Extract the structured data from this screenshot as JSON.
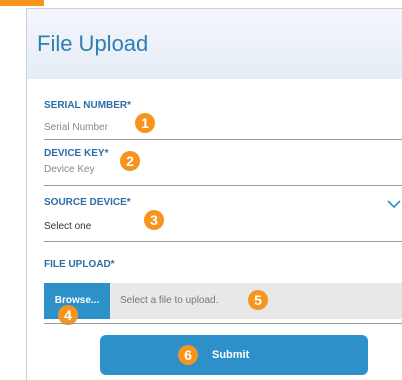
{
  "form": {
    "title": "File Upload",
    "serial_number": {
      "label": "SERIAL NUMBER*",
      "placeholder": "Serial Number"
    },
    "device_key": {
      "label": "DEVICE KEY*",
      "placeholder": "Device Key"
    },
    "source_device": {
      "label": "SOURCE DEVICE*",
      "selected": "Select one",
      "icon": "chevron-down-icon"
    },
    "file_upload": {
      "label": "FILE UPLOAD*",
      "browse_label": "Browse...",
      "placeholder": "Select a file to upload."
    },
    "submit_label": "Submit"
  },
  "callouts": [
    "1",
    "2",
    "3",
    "4",
    "5",
    "6"
  ],
  "colors": {
    "accent": "#2e90c8",
    "label": "#2b6ea8",
    "badge": "#f7941d",
    "title": "#2d7fb5"
  }
}
